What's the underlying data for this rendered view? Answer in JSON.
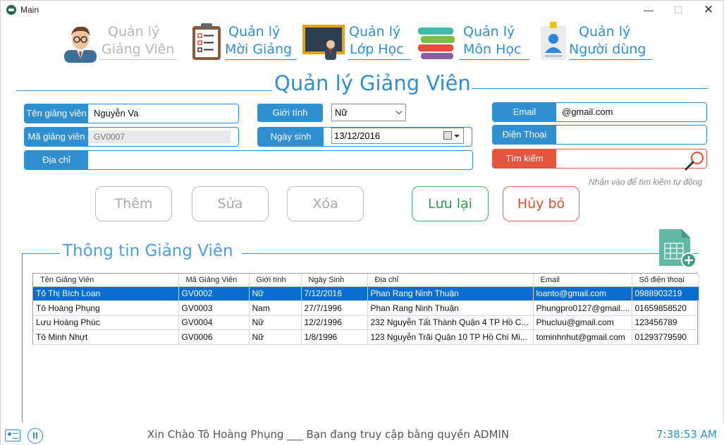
{
  "window": {
    "title": "Main"
  },
  "menu": [
    {
      "line1": "Quản lý",
      "line2": "Giảng Viên",
      "icon": "teacher-avatar-icon",
      "disabled": true
    },
    {
      "line1": "Quản lý",
      "line2": "Mời Giảng",
      "icon": "clipboard-checklist-icon",
      "disabled": false
    },
    {
      "line1": "Quản lý",
      "line2": "Lớp Học",
      "icon": "classroom-blackboard-icon",
      "disabled": false
    },
    {
      "line1": "Quản lý",
      "line2": "Môn Học",
      "icon": "books-stack-icon",
      "disabled": false
    },
    {
      "line1": "Quản lý",
      "line2": "Người dùng",
      "icon": "user-id-icon",
      "disabled": false
    }
  ],
  "page_title": "Quản lý Giảng Viên",
  "form": {
    "ten_label": "Tên giảng viên",
    "ten_value": "Nguyễn Va",
    "ma_label": "Mã giảng viên",
    "ma_value": "GV0007",
    "diachi_label": "Địa chỉ",
    "diachi_value": "",
    "gioitinh_label": "Giới tính",
    "gioitinh_value": "Nữ",
    "ngaysinh_label": "Ngày sinh",
    "ngaysinh_value": "13/12/2016",
    "email_label": "Email",
    "email_value": "@gmail.com",
    "dienthoai_label": "Điện Thoại",
    "dienthoai_value": "",
    "timkiem_label": "Tìm kiếm",
    "timkiem_value": "",
    "hint": "Nhấn vào để tìm kiếm tự động"
  },
  "buttons": {
    "them": "Thêm",
    "sua": "Sửa",
    "xoa": "Xóa",
    "luu": "Lưu lại",
    "huy": "Hủy bỏ"
  },
  "group_title": "Thông tin Giảng Viên",
  "table": {
    "headers": [
      "Tên Giảng Viên",
      "Mã Giảng Viên",
      "Giới tính",
      "Ngày Sinh",
      "Địa chỉ",
      "Email",
      "Số điện thoại"
    ],
    "rows": [
      [
        "Tô Thị Bích Loan",
        "GV0002",
        "Nữ",
        "7/12/2016",
        "Phan Rang Ninh Thuận",
        "loanto@gmail.com",
        "0988903219"
      ],
      [
        "Tô Hoàng Phụng",
        "GV0003",
        "Nam",
        "27/7/1996",
        "Phan Rang Ninh Thuận",
        "Phungpro0127@gmail....",
        "01659858520"
      ],
      [
        "Lưu Hoàng Phúc",
        "GV0004",
        "Nữ",
        "12/2/1996",
        "232 Nguyễn Tất Thành Quận 4 TP Hồ C...",
        "Phucluu@gmail.com",
        "123456789"
      ],
      [
        "Tô Minh Nhựt",
        "GV0006",
        "Nữ",
        "1/8/1996",
        "123 Nguyễn Trãi Quận 10 TP Hồ Chí Mi...",
        "tominhnhut@gmail.com",
        "01293779590"
      ]
    ],
    "selected_row": 0
  },
  "status": {
    "greeting": "Xin Chào Tô Hoàng Phụng ___ Bạn đang truy cập bằng quyền ADMIN",
    "time": "7:38:53 AM"
  },
  "colors": {
    "accent": "#2f8fd0",
    "danger": "#e4553f",
    "success": "#44b466",
    "selection": "#0a6ed1"
  }
}
